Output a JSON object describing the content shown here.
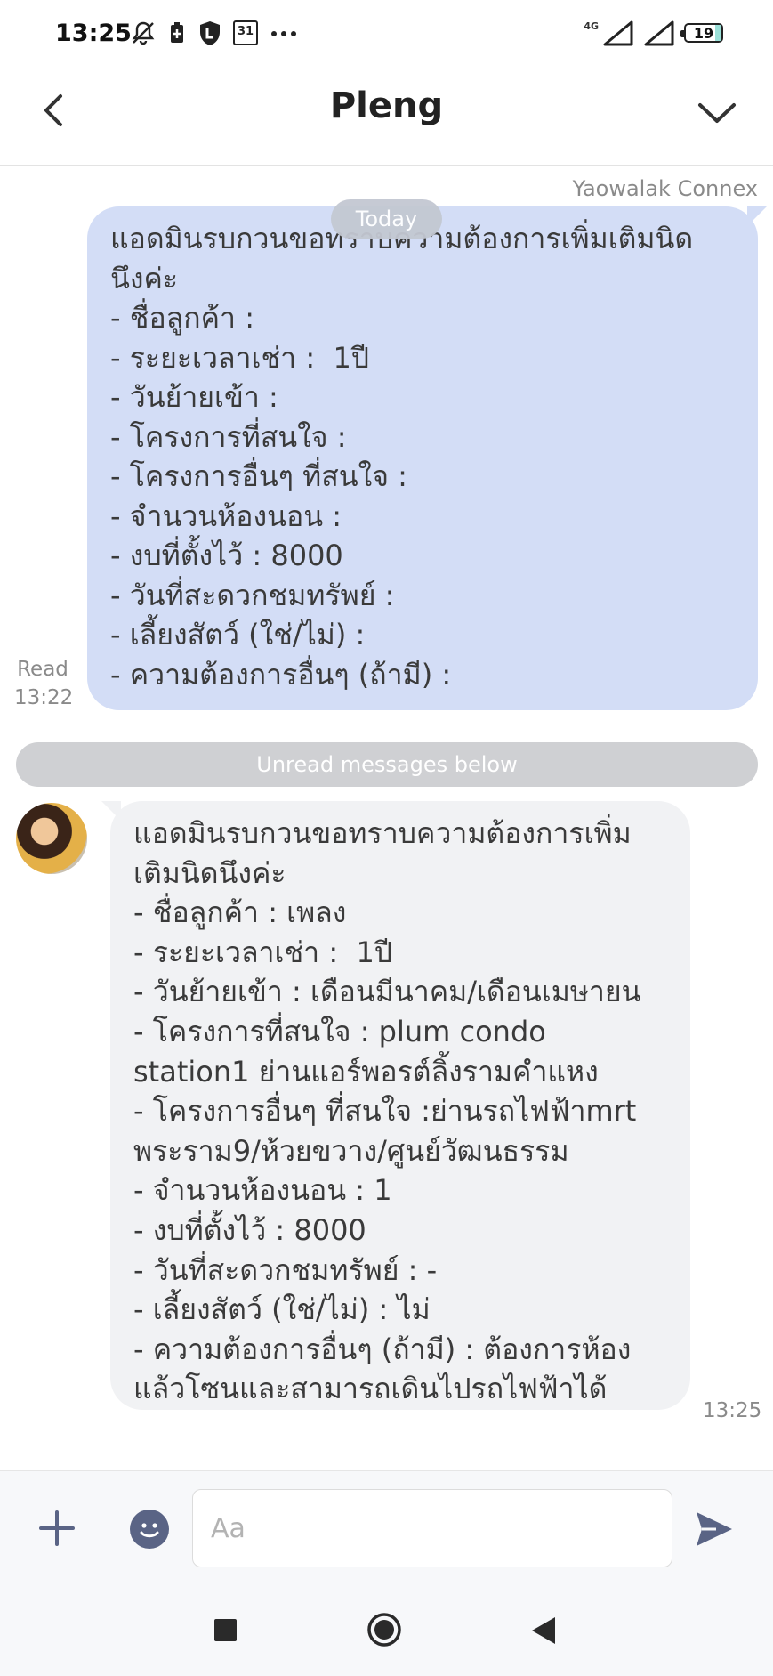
{
  "status_bar": {
    "time": "13:25",
    "calendar_day": "31",
    "network": "4G",
    "battery": "19"
  },
  "header": {
    "title": "Pleng"
  },
  "chat": {
    "sender_name": "Yaowalak Connex",
    "today_label": "Today",
    "outgoing_message": {
      "text": "แอดมินรบกวนขอทราบความต้องการเพิ่มเติมนิด\nนึงค่ะ\n- ชื่อลูกค้า :\n- ระยะเวลาเช่า :  1ปี\n- วันย้ายเข้า :\n- โครงการที่สนใจ :\n- โครงการอื่นๆ ที่สนใจ :\n- จำนวนห้องนอน :\n- งบที่ตั้งไว้ : 8000\n- วันที่สะดวกชมทรัพย์ :\n- เลี้ยงสัตว์ (ใช่/ไม่) :\n- ความต้องการอื่นๆ (ถ้ามี) :",
      "read_label": "Read",
      "time": "13:22"
    },
    "unread_divider": "Unread messages below",
    "incoming_message": {
      "text": "แอดมินรบกวนขอทราบความต้องการเพิ่ม\nเติมนิดนึงค่ะ\n- ชื่อลูกค้า : เพลง\n- ระยะเวลาเช่า :  1ปี\n- วันย้ายเข้า : เดือนมีนาคม/เดือนเมษายน\n- โครงการที่สนใจ : plum condo\nstation1 ย่านแอร์พอรต์ลิ้งรามคำแหง\n- โครงการอื่นๆ ที่สนใจ :ย่านรถไฟฟ้าmrt\nพระราม9/ห้วยขวาง/ศูนย์วัฒนธรรม\n- จำนวนห้องนอน : 1\n- งบที่ตั้งไว้ : 8000\n- วันที่สะดวกชมทรัพย์ : -\n- เลี้ยงสัตว์ (ใช่/ไม่) : ไม่\n- ความต้องการอื่นๆ (ถ้ามี) : ต้องการห้อง\nแล้วโซนและสามารถเดินไปรถไฟฟ้าได้",
      "time": "13:25"
    }
  },
  "composer": {
    "placeholder": "Aa"
  },
  "colors": {
    "outgoing_bubble": "#d3ddf6",
    "incoming_bubble": "#f1f2f4",
    "send_icon": "#5a6485"
  }
}
